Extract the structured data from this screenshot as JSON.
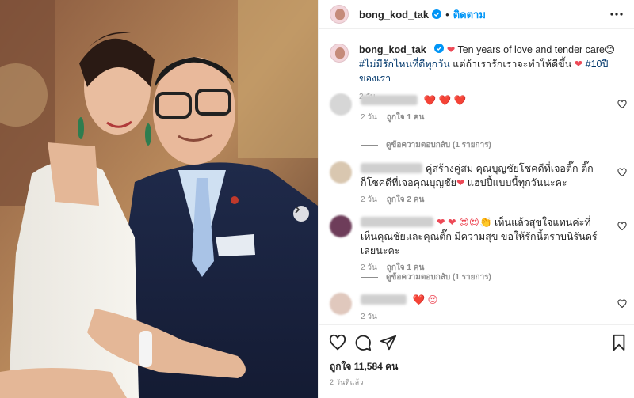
{
  "post": {
    "username": "bong_kod_tak",
    "follow_label": "ติดตาม",
    "caption_text": "Ten years of love and tender care",
    "caption_hash1": "#ไม่มีรักไหนที่ดีทุกวัน",
    "caption_mid": " แต่ถ้าเรารักเราจะทำให้ดีขึ้น ",
    "caption_hash2": "#10ปีของเรา",
    "caption_time": "2 วัน"
  },
  "comments": [
    {
      "text": "❤️ ❤️ ❤️",
      "time": "2 วัน",
      "likes": "ถูกใจ 1 คน"
    },
    {
      "text": "คู่สร้างคู่สม คุณบุญชัยโชคดีที่เจอติ๊ก ติ๊กก็โชคดีที่เจอคุณบุญชัย",
      "text_tail": " แฮปปี้แบบนี้ทุกวันนะคะ",
      "time": "2 วัน",
      "likes": "ถูกใจ 2 คน"
    },
    {
      "text": "เห็นแล้วสุขใจแทนค่ะที่เห็นคุณชัยและคุณติ๊ก มีความสุข ขอให้รักนี้ตราบนิรันดร์เลยนะคะ",
      "time": "2 วัน",
      "likes": "ถูกใจ 1 คน"
    },
    {
      "text": "❤️ 😍",
      "time": "2 วัน"
    }
  ],
  "replies": [
    {
      "label": "ดูข้อความตอบกลับ (1 รายการ)"
    },
    {
      "label": "ดูข้อความตอบกลับ (1 รายการ)"
    }
  ],
  "footer": {
    "likes": "ถูกใจ 11,584 คน",
    "date": "2 วันที่แล้ว"
  },
  "colors": {
    "accent": "#0095f6",
    "heart": "#ed4956",
    "hashtag": "#00376b",
    "muted": "#8e8e8e"
  },
  "icons": [
    "verified-badge-icon",
    "more-options-icon",
    "heart-icon",
    "comment-icon",
    "share-icon",
    "bookmark-icon",
    "next-arrow-icon"
  ]
}
